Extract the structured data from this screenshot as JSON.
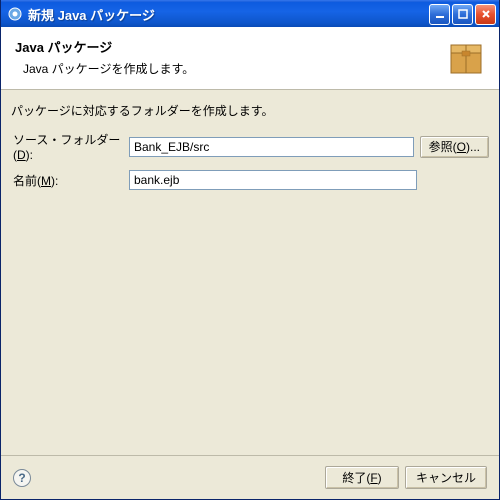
{
  "titlebar": {
    "title": "新規 Java パッケージ"
  },
  "header": {
    "title": "Java パッケージ",
    "subtitle": "Java パッケージを作成します。"
  },
  "content": {
    "instruction": "パッケージに対応するフォルダーを作成します。",
    "sourceFolder": {
      "label_pre": "ソース・フォルダー(",
      "label_acc": "D",
      "label_post": "):",
      "value": "Bank_EJB/src",
      "browse_pre": "参照(",
      "browse_acc": "O",
      "browse_post": ")..."
    },
    "name": {
      "label_pre": "名前(",
      "label_acc": "M",
      "label_post": "):",
      "value": "bank.ejb"
    }
  },
  "footer": {
    "finish_pre": "終了(",
    "finish_acc": "F",
    "finish_post": ")",
    "cancel": "キャンセル"
  }
}
